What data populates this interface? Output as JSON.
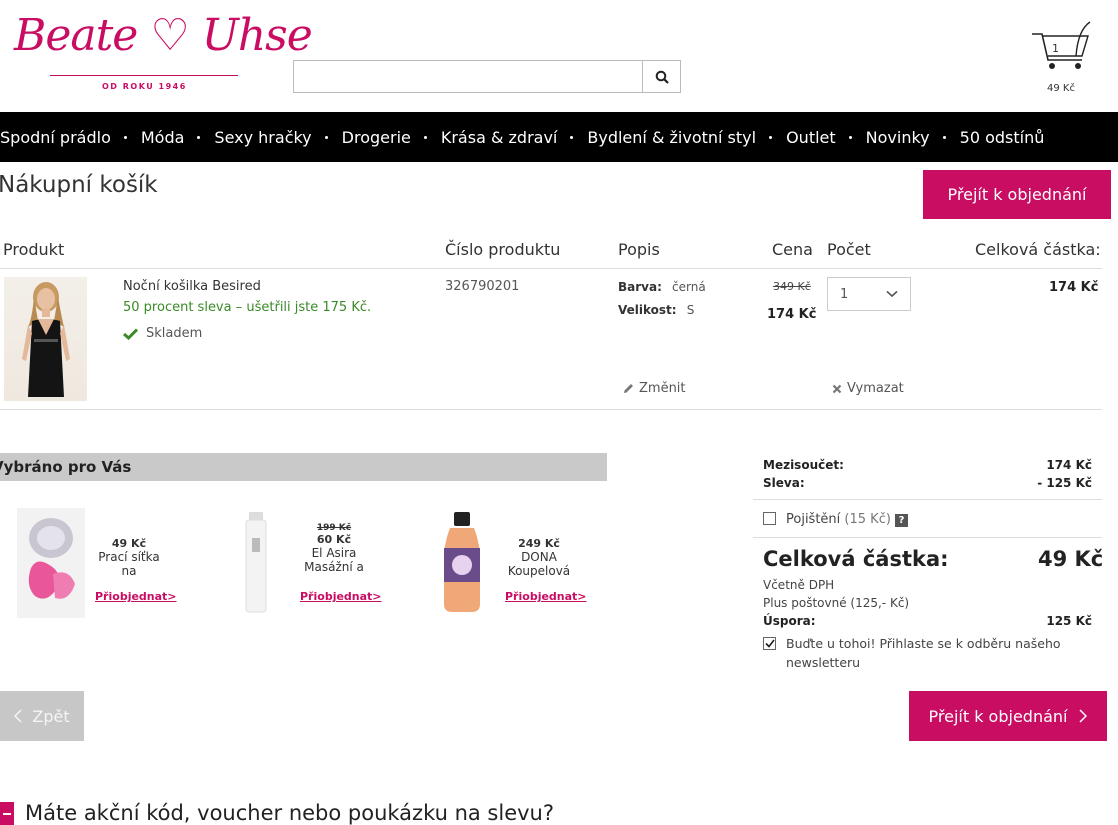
{
  "header": {
    "logo_text": "Beate ♡ Uhse",
    "logo_sub": "OD ROKU 1946",
    "search_placeholder": "",
    "cart_count": "1",
    "cart_total": "49 Kč"
  },
  "nav": {
    "items": [
      "Spodní prádlo",
      "Móda",
      "Sexy hračky",
      "Drogerie",
      "Krása & zdraví",
      "Bydlení & životní styl",
      "Outlet",
      "Novinky",
      "50 odstínů"
    ]
  },
  "cart": {
    "title": "Nákupní košík",
    "checkout_label": "Přejít k objednání",
    "columns": {
      "product": "Produkt",
      "number": "Číslo produktu",
      "description": "Popis",
      "price": "Cena",
      "quantity": "Počet",
      "total": "Celková částka:"
    },
    "item": {
      "name": "Noční košilka Besired",
      "discount": "50 procent sleva – ušetřili jste 175 Kč.",
      "stock": "Skladem",
      "number": "326790201",
      "color_label": "Barva:",
      "color_value": "černá",
      "size_label": "Velikost:",
      "size_value": "S",
      "old_price": "349 Kč",
      "new_price": "174 Kč",
      "quantity": "1",
      "total": "174 Kč",
      "edit_label": "Změnit",
      "delete_label": "Vymazat"
    }
  },
  "recommended": {
    "title": "Vybráno pro Vás",
    "order_label": "Přiobjednat>",
    "items": [
      {
        "price": "49 Kč",
        "old_price": "",
        "name_1": "Prací síťka",
        "name_2": "na"
      },
      {
        "price": "60 Kč",
        "old_price": "199 Kč",
        "name_1": "El Asira",
        "name_2": "Masážní a"
      },
      {
        "price": "249 Kč",
        "old_price": "",
        "name_1": "DONA",
        "name_2": "Koupelová"
      }
    ]
  },
  "summary": {
    "subtotal_label": "Mezisoučet:",
    "subtotal_value": "174 Kč",
    "discount_label": "Sleva:",
    "discount_value": "- 125 Kč",
    "insurance_label": "Pojištění",
    "insurance_price": "(15 Kč)",
    "insurance_help": "?",
    "total_label": "Celková částka:",
    "total_value": "49 Kč",
    "vat_note": "Včetně DPH",
    "shipping_note": "Plus poštovné (125,- Kč)",
    "savings_label": "Úspora:",
    "savings_value": "125 Kč",
    "newsletter_line1": "Buďte u tohoi! Přihlaste se k odběru našeho",
    "newsletter_line2": "newsletteru"
  },
  "footer": {
    "back_label": "Zpět",
    "checkout_label": "Přejít k objednání",
    "voucher_text": "Máte akční kód, voucher nebo poukázku na slevu?"
  },
  "colors": {
    "brand": "#c80d63",
    "nav_bg": "#000000",
    "discount_green": "#3a8a28"
  }
}
